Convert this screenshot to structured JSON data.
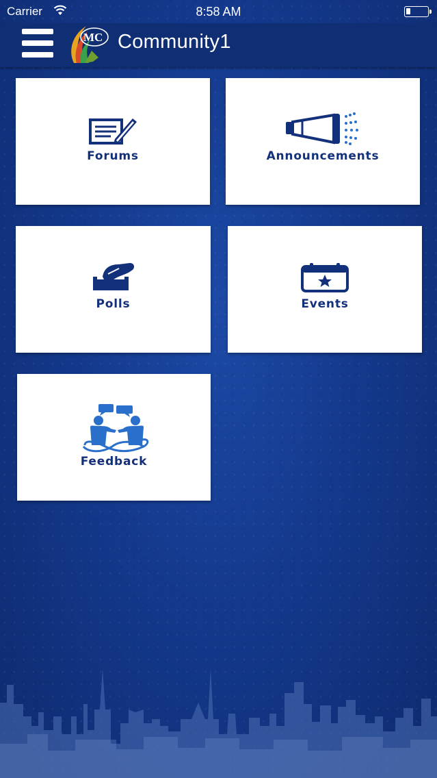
{
  "status_bar": {
    "carrier": "Carrier",
    "time": "8:58 AM",
    "wifi_icon": "wifi-icon",
    "battery_icon": "battery-icon"
  },
  "header": {
    "menu_icon": "hamburger-menu-icon",
    "logo_text": "MC",
    "title": "Community1"
  },
  "tiles": [
    {
      "label": "Forums",
      "icon": "forum-document-pen-icon"
    },
    {
      "label": "Announcements",
      "icon": "megaphone-icon"
    },
    {
      "label": "Polls",
      "icon": "ballot-box-hand-icon"
    },
    {
      "label": "Events",
      "icon": "calendar-star-icon"
    },
    {
      "label": "Feedback",
      "icon": "people-speech-bubbles-icon"
    }
  ],
  "colors": {
    "background": "#14398c",
    "header": "#102e73",
    "tile": "#ffffff",
    "tile_text": "#13307a",
    "icon": "#13307a",
    "icon_accent": "#2a6fc9"
  }
}
